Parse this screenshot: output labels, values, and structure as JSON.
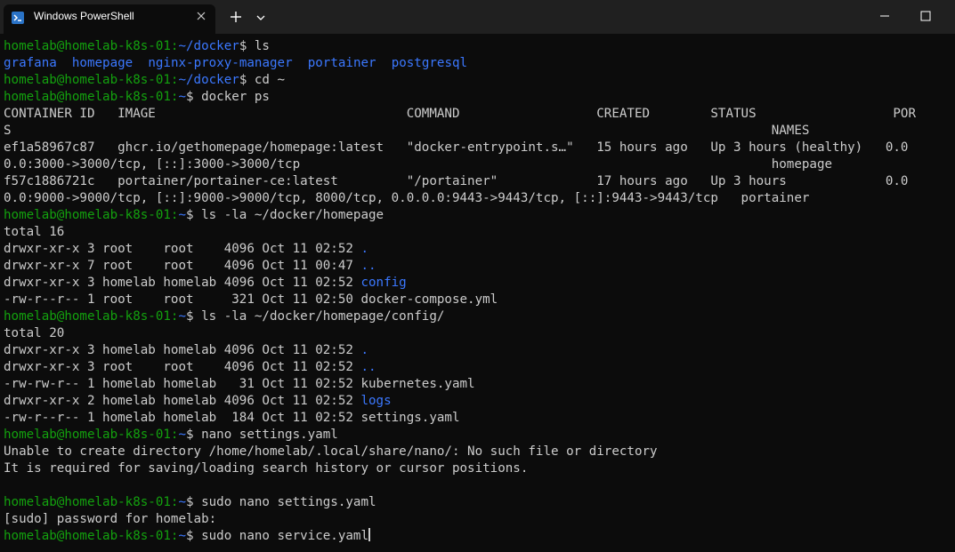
{
  "window": {
    "tab_title": "Windows PowerShell",
    "tab_icon": "powershell-icon",
    "new_tab_icon": "plus-icon",
    "dropdown_icon": "chevron-down-icon",
    "minimize_icon": "minimize-icon",
    "maximize_icon": "maximize-icon"
  },
  "colors": {
    "background": "#0c0c0c",
    "titlebar": "#202020",
    "prompt": "#13a10e",
    "path": "#3b78ff",
    "directory": "#3b78ff",
    "text": "#cccccc"
  },
  "terminal": {
    "lines": [
      [
        {
          "t": "homelab@homelab-k8s-01:",
          "c": "green"
        },
        {
          "t": "~/docker",
          "c": "blue"
        },
        {
          "t": "$ ls",
          "c": "white"
        }
      ],
      [
        {
          "t": "grafana",
          "c": "blue"
        },
        {
          "t": "  ",
          "c": "white"
        },
        {
          "t": "homepage",
          "c": "blue"
        },
        {
          "t": "  ",
          "c": "white"
        },
        {
          "t": "nginx-proxy-manager",
          "c": "blue"
        },
        {
          "t": "  ",
          "c": "white"
        },
        {
          "t": "portainer",
          "c": "blue"
        },
        {
          "t": "  ",
          "c": "white"
        },
        {
          "t": "postgresql",
          "c": "blue"
        }
      ],
      [
        {
          "t": "homelab@homelab-k8s-01:",
          "c": "green"
        },
        {
          "t": "~/docker",
          "c": "blue"
        },
        {
          "t": "$ cd ~",
          "c": "white"
        }
      ],
      [
        {
          "t": "homelab@homelab-k8s-01:",
          "c": "green"
        },
        {
          "t": "~",
          "c": "blue"
        },
        {
          "t": "$ docker ps",
          "c": "white"
        }
      ],
      [
        {
          "t": "CONTAINER ID   IMAGE                                 COMMAND                  CREATED        STATUS                  POR",
          "c": "white"
        }
      ],
      [
        {
          "t": "S                                                                                                    NAMES",
          "c": "white"
        }
      ],
      [
        {
          "t": "ef1a58967c87   ghcr.io/gethomepage/homepage:latest   \"docker-entrypoint.s…\"   15 hours ago   Up 3 hours (healthy)   0.0",
          "c": "white"
        }
      ],
      [
        {
          "t": "0.0:3000->3000/tcp, [::]:3000->3000/tcp                                                              homepage",
          "c": "white"
        }
      ],
      [
        {
          "t": "f57c1886721c   portainer/portainer-ce:latest         \"/portainer\"             17 hours ago   Up 3 hours             0.0",
          "c": "white"
        }
      ],
      [
        {
          "t": "0.0:9000->9000/tcp, [::]:9000->9000/tcp, 8000/tcp, 0.0.0.0:9443->9443/tcp, [::]:9443->9443/tcp   portainer",
          "c": "white"
        }
      ],
      [
        {
          "t": "homelab@homelab-k8s-01:",
          "c": "green"
        },
        {
          "t": "~",
          "c": "blue"
        },
        {
          "t": "$ ls -la ~/docker/homepage",
          "c": "white"
        }
      ],
      [
        {
          "t": "total 16",
          "c": "white"
        }
      ],
      [
        {
          "t": "drwxr-xr-x 3 root    root    4096 Oct 11 02:52 ",
          "c": "white"
        },
        {
          "t": ".",
          "c": "blue"
        }
      ],
      [
        {
          "t": "drwxr-xr-x 7 root    root    4096 Oct 11 00:47 ",
          "c": "white"
        },
        {
          "t": "..",
          "c": "blue"
        }
      ],
      [
        {
          "t": "drwxr-xr-x 3 homelab homelab 4096 Oct 11 02:52 ",
          "c": "white"
        },
        {
          "t": "config",
          "c": "blue"
        }
      ],
      [
        {
          "t": "-rw-r--r-- 1 root    root     321 Oct 11 02:50 docker-compose.yml",
          "c": "white"
        }
      ],
      [
        {
          "t": "homelab@homelab-k8s-01:",
          "c": "green"
        },
        {
          "t": "~",
          "c": "blue"
        },
        {
          "t": "$ ls -la ~/docker/homepage/config/",
          "c": "white"
        }
      ],
      [
        {
          "t": "total 20",
          "c": "white"
        }
      ],
      [
        {
          "t": "drwxr-xr-x 3 homelab homelab 4096 Oct 11 02:52 ",
          "c": "white"
        },
        {
          "t": ".",
          "c": "blue"
        }
      ],
      [
        {
          "t": "drwxr-xr-x 3 root    root    4096 Oct 11 02:52 ",
          "c": "white"
        },
        {
          "t": "..",
          "c": "blue"
        }
      ],
      [
        {
          "t": "-rw-rw-r-- 1 homelab homelab   31 Oct 11 02:52 kubernetes.yaml",
          "c": "white"
        }
      ],
      [
        {
          "t": "drwxr-xr-x 2 homelab homelab 4096 Oct 11 02:52 ",
          "c": "white"
        },
        {
          "t": "logs",
          "c": "blue"
        }
      ],
      [
        {
          "t": "-rw-r--r-- 1 homelab homelab  184 Oct 11 02:52 settings.yaml",
          "c": "white"
        }
      ],
      [
        {
          "t": "homelab@homelab-k8s-01:",
          "c": "green"
        },
        {
          "t": "~",
          "c": "blue"
        },
        {
          "t": "$ nano settings.yaml",
          "c": "white"
        }
      ],
      [
        {
          "t": "Unable to create directory /home/homelab/.local/share/nano/: No such file or directory",
          "c": "white"
        }
      ],
      [
        {
          "t": "It is required for saving/loading search history or cursor positions.",
          "c": "white"
        }
      ],
      [],
      [
        {
          "t": "homelab@homelab-k8s-01:",
          "c": "green"
        },
        {
          "t": "~",
          "c": "blue"
        },
        {
          "t": "$ sudo nano settings.yaml",
          "c": "white"
        }
      ],
      [
        {
          "t": "[sudo] password for homelab:",
          "c": "white"
        }
      ],
      [
        {
          "t": "homelab@homelab-k8s-01:",
          "c": "green"
        },
        {
          "t": "~",
          "c": "blue"
        },
        {
          "t": "$ sudo nano service.yaml",
          "c": "white"
        }
      ]
    ]
  }
}
